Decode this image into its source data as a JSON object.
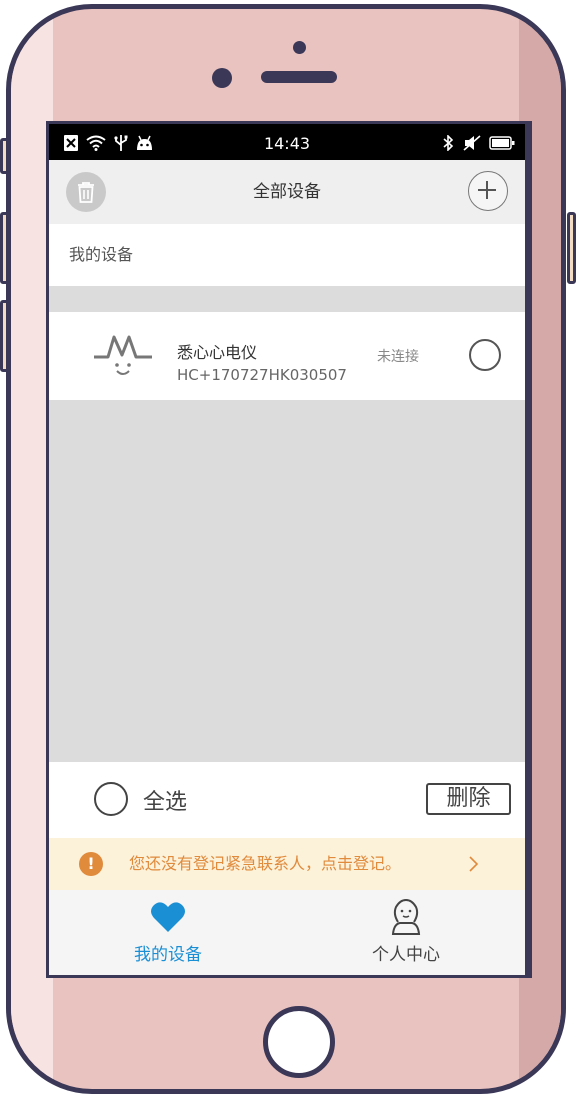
{
  "status_bar": {
    "time": "14:43",
    "left_icons": [
      "sim-x-icon",
      "wifi-icon",
      "usb-icon",
      "android-icon"
    ],
    "right_icons": [
      "bluetooth-icon",
      "muted-icon",
      "battery-icon"
    ]
  },
  "nav": {
    "title": "全部设备",
    "left_icon": "trash-icon",
    "right_icon": "plus-icon"
  },
  "section": {
    "header": "我的设备"
  },
  "devices": [
    {
      "name": "悉心心电仪",
      "id": "HC+170727HK030507",
      "status": "未连接",
      "icon": "heartbeat-face-icon"
    }
  ],
  "actions": {
    "select_all": "全选",
    "delete": "删除"
  },
  "emergency": {
    "text": "您还没有登记紧急联系人，点击登记。",
    "color": "#e08a3c",
    "background": "#fcf1d9"
  },
  "tabs": [
    {
      "label": "我的设备",
      "icon": "heart-icon",
      "active": true,
      "color": "#1b8fd4"
    },
    {
      "label": "个人中心",
      "icon": "person-icon",
      "active": false,
      "color": "#444444"
    }
  ]
}
